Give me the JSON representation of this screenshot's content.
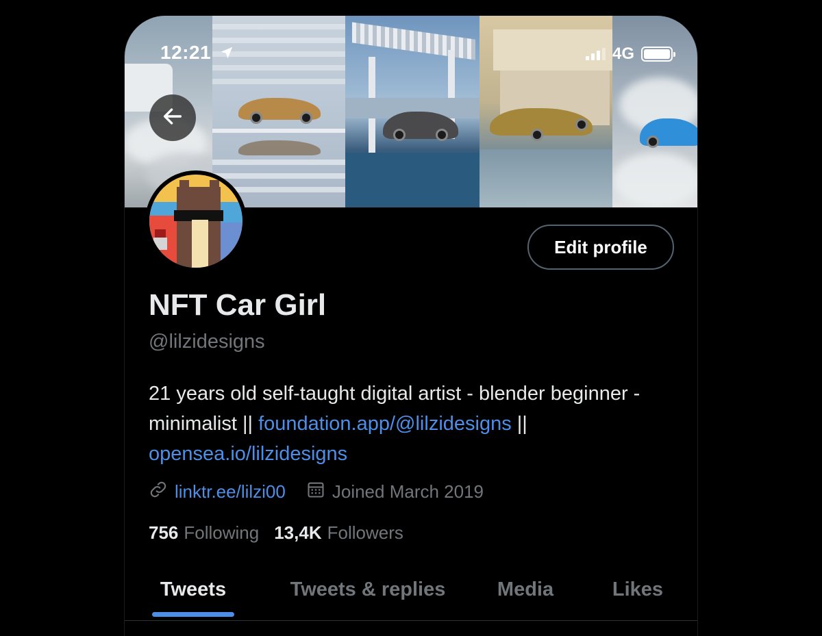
{
  "status_bar": {
    "time": "12:21",
    "network": "4G"
  },
  "profile": {
    "display_name": "NFT Car Girl",
    "handle": "@lilzidesigns",
    "bio_text_1": "21 years old self-taught digital artist - blender beginner - minimalist || ",
    "bio_link_1": "foundation.app/@lilzidesigns",
    "bio_text_2": " || ",
    "bio_link_2": "opensea.io/lilzidesigns",
    "website": "linktr.ee/lilzi00",
    "joined": "Joined March 2019",
    "following_count": "756",
    "following_label": "Following",
    "followers_count": "13,4K",
    "followers_label": "Followers"
  },
  "buttons": {
    "edit_profile": "Edit profile"
  },
  "tabs": [
    {
      "label": "Tweets",
      "active": true
    },
    {
      "label": "Tweets & replies",
      "active": false
    },
    {
      "label": "Media",
      "active": false
    },
    {
      "label": "Likes",
      "active": false
    }
  ],
  "icons": {
    "back": "arrow-left-icon",
    "location_arrow": "navigation-arrow-icon",
    "signal": "cellular-signal-icon",
    "battery": "battery-icon",
    "link": "link-icon",
    "calendar": "calendar-icon"
  },
  "colors": {
    "background": "#000000",
    "accent": "#4d8fe8",
    "muted": "#71767b",
    "text": "#e7e9ea"
  }
}
